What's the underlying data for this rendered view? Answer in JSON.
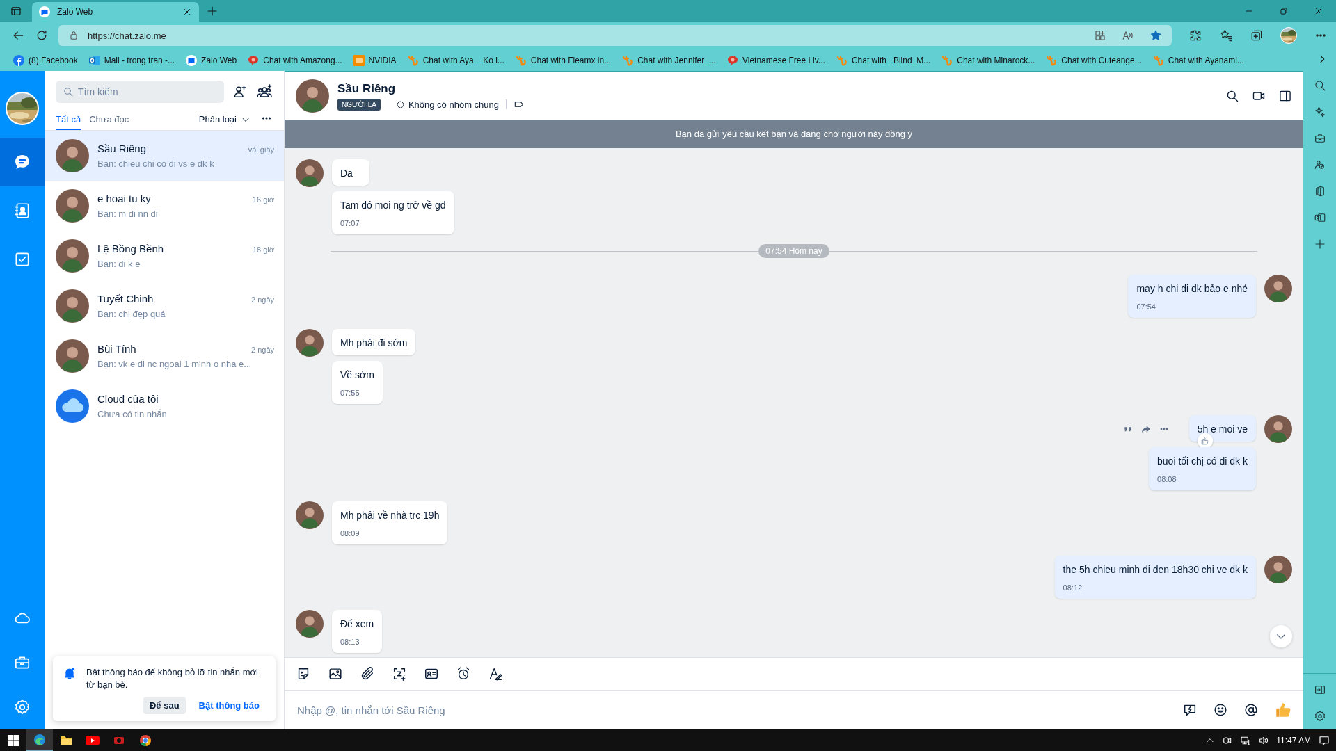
{
  "browser": {
    "tab_title": "Zalo Web",
    "url": "https://chat.zalo.me",
    "bookmarks": [
      {
        "label": "(8) Facebook",
        "kind": "facebook"
      },
      {
        "label": "Mail - trong tran -...",
        "kind": "outlook"
      },
      {
        "label": "Zalo Web",
        "kind": "zalo"
      },
      {
        "label": "Chat with Amazong...",
        "kind": "redchat"
      },
      {
        "label": "NVIDIA",
        "kind": "hd"
      },
      {
        "label": "Chat with Aya__Ko i...",
        "kind": "cat"
      },
      {
        "label": "Chat with Fleamx in...",
        "kind": "cat"
      },
      {
        "label": "Chat with Jennifer_...",
        "kind": "cat"
      },
      {
        "label": "Vietnamese Free Liv...",
        "kind": "redchat"
      },
      {
        "label": "Chat with _Blind_M...",
        "kind": "cat"
      },
      {
        "label": "Chat with Minarock...",
        "kind": "cat"
      },
      {
        "label": "Chat with Cuteange...",
        "kind": "cat"
      },
      {
        "label": "Chat with Ayanami...",
        "kind": "cat"
      }
    ]
  },
  "sidebar": {
    "nav": [
      {
        "kind": "chat",
        "selected": true
      },
      {
        "kind": "contacts",
        "selected": false
      },
      {
        "kind": "todo",
        "selected": false
      }
    ]
  },
  "chat_list": {
    "search_placeholder": "Tìm kiếm",
    "tabs": [
      {
        "label": "Tất cả",
        "selected": true
      },
      {
        "label": "Chưa đọc",
        "selected": false
      }
    ],
    "filter": "Phân loại",
    "conversations": [
      {
        "name": "Sầu Riêng",
        "preview": "Bạn: chieu chi co di vs e dk k",
        "time": "vài giây",
        "selected": true,
        "kind": "person"
      },
      {
        "name": "e hoai tu ky",
        "preview": "Bạn: m di nn di",
        "time": "16 giờ",
        "selected": false,
        "kind": "person"
      },
      {
        "name": "Lệ Bồng Bềnh",
        "preview": "Bạn: di k e",
        "time": "18 giờ",
        "selected": false,
        "kind": "person"
      },
      {
        "name": "Tuyết Chinh",
        "preview": "Bạn: chị đẹp quá",
        "time": "2 ngày",
        "selected": false,
        "kind": "person"
      },
      {
        "name": "Bùi Tính",
        "preview": "Bạn: vk e di nc ngoai 1 minh o nha e...",
        "time": "2 ngày",
        "selected": false,
        "kind": "person"
      },
      {
        "name": "Cloud của tôi",
        "preview": "Chưa có tin nhắn",
        "selected": false,
        "kind": "cloud"
      }
    ]
  },
  "notification": {
    "text": "Bật thông báo để không bỏ lỡ tin nhắn mới từ bạn bè.",
    "buttons": [
      "Để sau",
      "Bật thông báo"
    ]
  },
  "chat": {
    "name": "Sầu Riêng",
    "badge": "NGƯỜI LẠ",
    "groups": "Không có nhóm chung",
    "banner": "Bạn đã gửi yêu cầu kết bạn và đang chờ người này đồng ý",
    "messages": [
      {
        "kind": "incoming",
        "text": "Da",
        "avatar": true
      },
      {
        "kind": "incoming",
        "text": "Tam đó moi ng trở về gđ",
        "time": "07:07",
        "avatar": false
      },
      {
        "kind": "divider",
        "text": "07:54 Hôm nay"
      },
      {
        "kind": "outgoing",
        "text": "may h chi di dk bảo e nhé",
        "time": "07:54",
        "avatar": true
      },
      {
        "kind": "incoming",
        "text": "Mh phải đi sớm",
        "avatar": true
      },
      {
        "kind": "incoming",
        "text": "Về sớm",
        "time": "07:55",
        "avatar": false
      },
      {
        "kind": "outgoing",
        "text": "5h e moi ve",
        "avatar": true,
        "hover": true
      },
      {
        "kind": "outgoing",
        "text": "buoi tối chị có đi dk k",
        "time": "08:08",
        "avatar": false
      },
      {
        "kind": "incoming",
        "text": "Mh phải về nhà trc 19h",
        "time": "08:09",
        "avatar": true
      },
      {
        "kind": "outgoing",
        "text": "the 5h chieu minh di den 18h30 chi ve dk k",
        "time": "08:12",
        "avatar": true
      },
      {
        "kind": "incoming",
        "text": "Để xem",
        "time": "08:13",
        "avatar": true
      }
    ],
    "input_placeholder": "Nhập @, tin nhắn tới Sầu Riêng"
  },
  "taskbar": {
    "time": "11:47 AM"
  }
}
